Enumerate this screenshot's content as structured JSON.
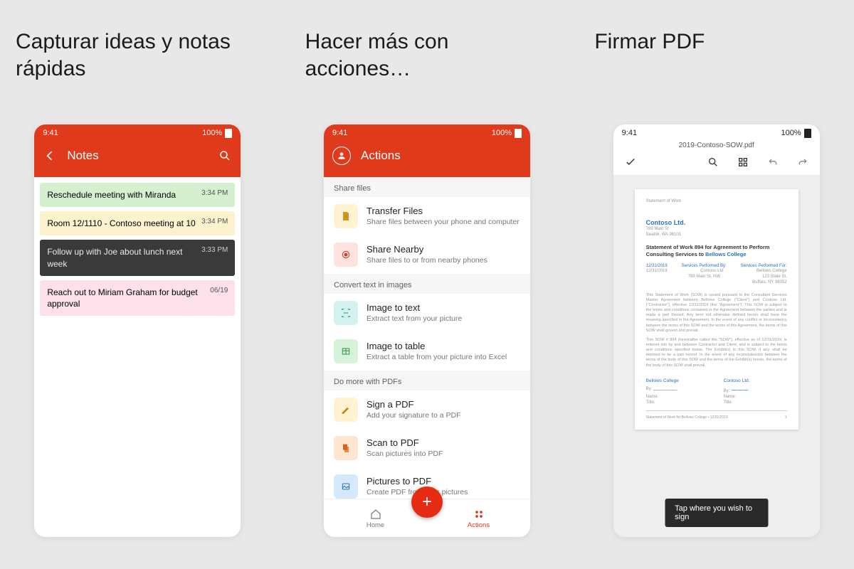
{
  "global": {
    "status_time": "9:41",
    "status_battery": "100%"
  },
  "panel1": {
    "title": "Capturar ideas y notas rápidas",
    "header_title": "Notes",
    "notes": [
      {
        "text": "Reschedule meeting with Miranda",
        "time": "3:34 PM",
        "color": "green"
      },
      {
        "text": "Room 12/1110 - Contoso meeting at 10",
        "time": "3:34 PM",
        "color": "yellow"
      },
      {
        "text": "Follow up with Joe about lunch next week",
        "time": "3:33 PM",
        "color": "dark"
      },
      {
        "text": "Reach out to Miriam Graham for budget approval",
        "time": "06/19",
        "color": "pink"
      }
    ]
  },
  "panel2": {
    "title": "Hacer más con acciones…",
    "header_title": "Actions",
    "sections": [
      {
        "label": "Share files",
        "items": [
          {
            "icon": "transfer-icon",
            "icon_class": "ic-yellow",
            "title": "Transfer Files",
            "subtitle": "Share files between your phone and computer"
          },
          {
            "icon": "share-nearby-icon",
            "icon_class": "ic-red",
            "title": "Share Nearby",
            "subtitle": "Share files to or from nearby phones"
          }
        ]
      },
      {
        "label": "Convert text in images",
        "items": [
          {
            "icon": "image-to-text-icon",
            "icon_class": "ic-teal",
            "title": "Image to text",
            "subtitle": "Extract text from your picture"
          },
          {
            "icon": "image-to-table-icon",
            "icon_class": "ic-green",
            "title": "Image to table",
            "subtitle": "Extract a table from your picture into Excel"
          }
        ]
      },
      {
        "label": "Do more with PDFs",
        "items": [
          {
            "icon": "sign-pdf-icon",
            "icon_class": "ic-yellow",
            "title": "Sign a PDF",
            "subtitle": "Add your signature to a PDF"
          },
          {
            "icon": "scan-pdf-icon",
            "icon_class": "ic-orange",
            "title": "Scan to PDF",
            "subtitle": "Scan pictures into PDF"
          },
          {
            "icon": "pictures-pdf-icon",
            "icon_class": "ic-blue",
            "title": "Pictures to PDF",
            "subtitle": "Create PDF from your pictures"
          }
        ]
      }
    ],
    "nav": {
      "home": "Home",
      "actions": "Actions"
    }
  },
  "panel3": {
    "title": "Firmar PDF",
    "filename": "2019-Contoso-SOW.pdf",
    "doc": {
      "type_label": "Statement of Work",
      "company": "Contoso Ltd.",
      "addr1": "789 Main St",
      "addr2": "Seattle, WA 98101",
      "sow_title": "Statement of Work 894 for Agreement to Perform Consulting Services to",
      "client": "Bellows College",
      "col_date": "12/31/2019",
      "col_head_by": "Services Performed By:",
      "col_head_for": "Services Performed For:",
      "by_name": "Contoso Ltd",
      "by_addr": "789 Main St, NW",
      "for_name": "Bellows College",
      "for_addr1": "123 State St,",
      "for_addr2": "Buffalo, NY 98052",
      "para1": "This Statement of Work (SOW) is issued pursuant to the Consultant Services Master Agreement between Bellows College (\"Client\") and Contoso Ltd. (\"Contractor\"), effective 12/31/2019 (the \"Agreement\"). This SOW is subject to the terms and conditions contained in the Agreement between the parties and is made a part thereof. Any term not otherwise defined herein shall have the meaning specified in the Agreement. In the event of any conflict or inconsistency between the terms of this SOW and the terms of this Agreement, the terms of this SOW shall govern and prevail.",
      "para2": "This SOW # 894 (hereinafter called the \"SOW\"), effective as of 12/31/2019, is entered into by and between Contractor and Client, and is subject to the terms and conditions specified below. The Exhibit(s) to this SOW, if any, shall be deemed to be a part hereof. In the event of any inconsistencies between the terms of the body of this SOW and the terms of the Exhibit(s) hereto, the terms of the body of this SOW shall prevail.",
      "sig_left_org": "Bellows College",
      "sig_right_org": "Contoso Ltd.",
      "sig_by": "By:",
      "sig_name": "Name:",
      "sig_title": "Title:",
      "footer": "Statement of Work for Bellows College • 12/31/2019",
      "page": "1"
    },
    "toast": "Tap where you wish to sign"
  }
}
